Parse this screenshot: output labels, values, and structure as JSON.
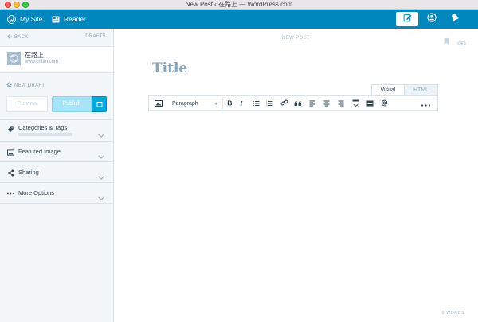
{
  "window": {
    "title": "New Post ‹ 在路上 — WordPress.com"
  },
  "masterbar": {
    "my_site_label": "My Site",
    "reader_label": "Reader",
    "icons": [
      "wordpress-logo-icon",
      "reader-icon",
      "write-post-icon",
      "profile-icon",
      "notifications-icon"
    ]
  },
  "sidebar": {
    "back_label": "BACK",
    "drafts_label": "DRAFTS",
    "site_name": "在路上",
    "site_url": "www.crifan.com",
    "new_draft_label": "NEW DRAFT",
    "preview_label": "Preview",
    "publish_label": "Publish",
    "sections": [
      {
        "label": "Categories & Tags",
        "icon": "tag-icon"
      },
      {
        "label": "Featured Image",
        "icon": "image-icon"
      },
      {
        "label": "Sharing",
        "icon": "share-icon"
      },
      {
        "label": "More Options",
        "icon": "ellipsis-icon"
      }
    ]
  },
  "editor": {
    "status_label": "NEW POST",
    "title_placeholder": "Title",
    "tabs": {
      "visual": "Visual",
      "html": "HTML"
    },
    "format_select_value": "Paragraph",
    "toolbar_icons": [
      "add-media-icon",
      "bold-icon",
      "italic-icon",
      "bullet-list-icon",
      "numbered-list-icon",
      "link-icon",
      "blockquote-icon",
      "align-left-icon",
      "align-center-icon",
      "align-right-icon",
      "insert-more-icon",
      "insert-content-icon",
      "mention-icon",
      "more-tools-icon"
    ],
    "word_count": "0 WORDS"
  },
  "colors": {
    "masterbar": "#0087be",
    "accent": "#00aadc",
    "publish_disabled": "#a8e4f8",
    "sidebar_bg": "#f3f6f8",
    "muted_text": "#87a6bc"
  }
}
